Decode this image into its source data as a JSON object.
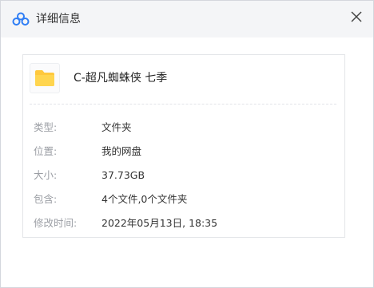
{
  "dialog": {
    "title": "详细信息",
    "app_icon": "cloud-logo-icon",
    "close_icon": "close-icon",
    "close_glyph": "✕"
  },
  "file": {
    "icon": "folder-icon",
    "name": "C-超凡蜘蛛侠 七季"
  },
  "properties": [
    {
      "label": "类型:",
      "value": "文件夹"
    },
    {
      "label": "位置:",
      "value": "我的网盘"
    },
    {
      "label": "大小:",
      "value": "37.73GB"
    },
    {
      "label": "包含:",
      "value": "4个文件,0个文件夹"
    },
    {
      "label": "修改时间:",
      "value": "2022年05月13日, 18:35"
    }
  ],
  "colors": {
    "brand_blue": "#2f7ef5",
    "folder_yellow": "#ffc83d"
  }
}
